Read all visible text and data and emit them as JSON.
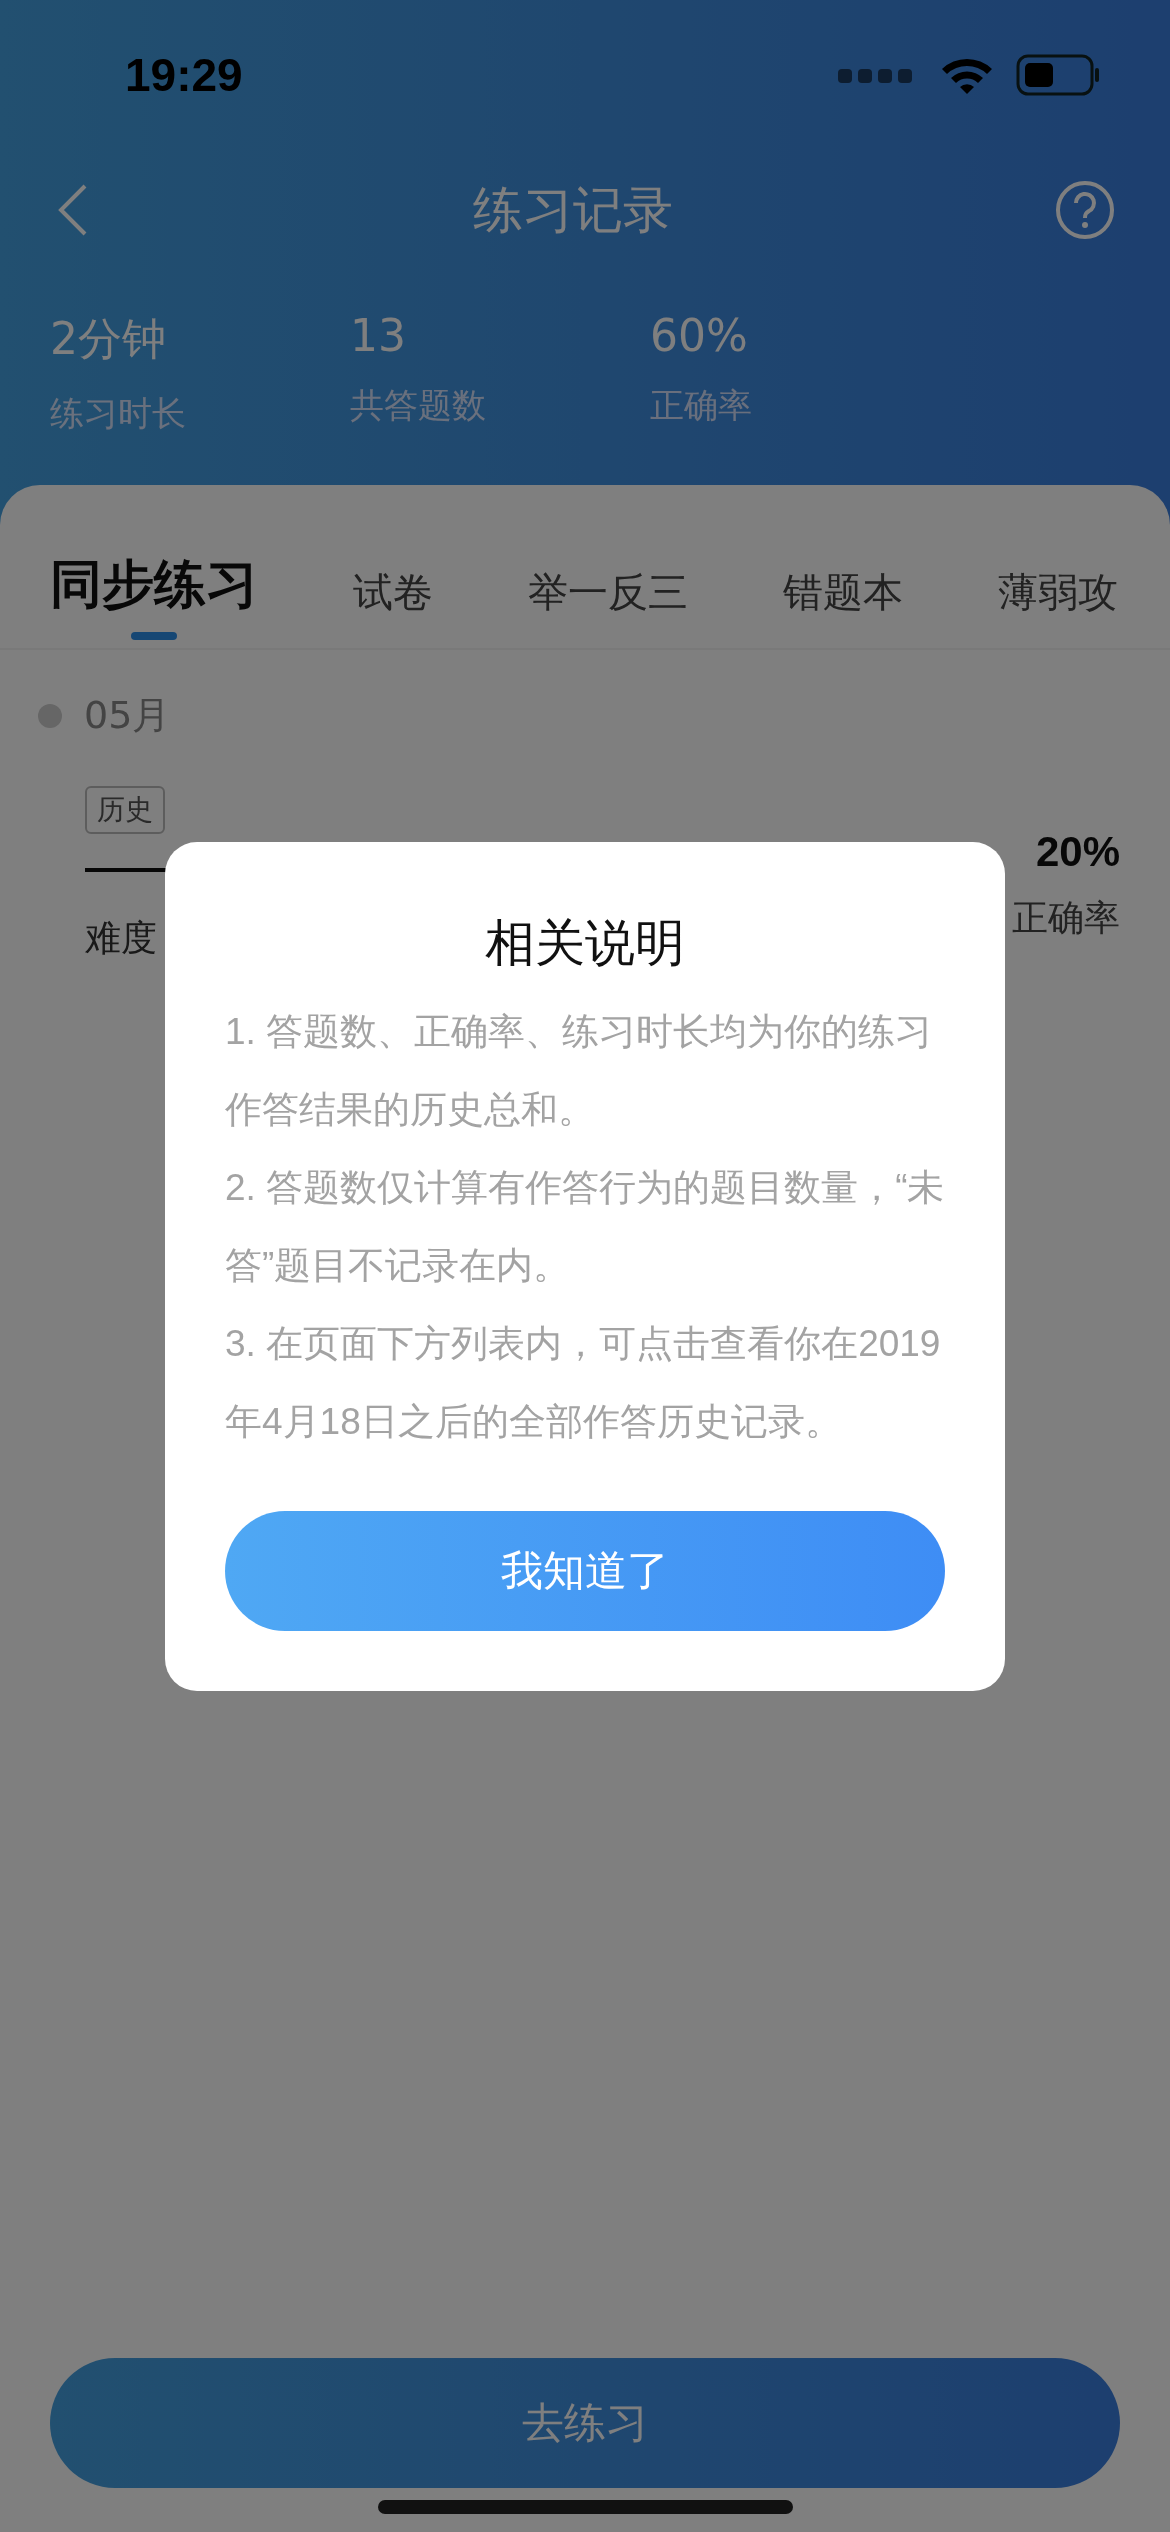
{
  "status_bar": {
    "time": "19:29"
  },
  "nav": {
    "title": "练习记录"
  },
  "stats": [
    {
      "value": "2分钟",
      "label": "练习时长"
    },
    {
      "value": "13",
      "label": "共答题数"
    },
    {
      "value": "60%",
      "label": "正确率"
    }
  ],
  "tabs": [
    {
      "label": "同步练习",
      "selected": true
    },
    {
      "label": "试卷",
      "selected": false
    },
    {
      "label": "举一反三",
      "selected": false
    },
    {
      "label": "错题本",
      "selected": false
    },
    {
      "label": "薄弱攻",
      "selected": false
    }
  ],
  "record": {
    "date": "05月",
    "tag": "历史",
    "difficulty_label": "难度",
    "accuracy": "20%",
    "accuracy_label": "正确率"
  },
  "dialog": {
    "title": "相关说明",
    "paragraphs": [
      "1. 答题数、正确率、练习时长均为你的练习作答结果的历史总和。",
      "2. 答题数仅计算有作答行为的题目数量，“未答”题目不记录在内。",
      "3. 在页面下方列表内，可点击查看你在2019年4月18日之后的全部作答历史记录。"
    ],
    "button": "我知道了"
  },
  "primary_button": "去练习"
}
